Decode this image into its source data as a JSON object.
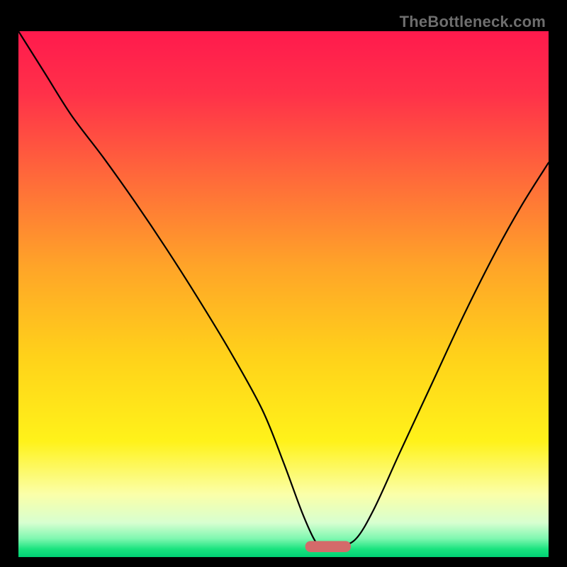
{
  "watermark": "TheBottleneck.com",
  "chart_data": {
    "type": "line",
    "title": "",
    "xlabel": "",
    "ylabel": "",
    "xlim": [
      0,
      100
    ],
    "ylim": [
      0,
      100
    ],
    "grid": false,
    "legend": false,
    "background_gradient_stops": [
      {
        "offset": 0.0,
        "color": "#ff1a4d"
      },
      {
        "offset": 0.12,
        "color": "#ff3149"
      },
      {
        "offset": 0.28,
        "color": "#ff6a3a"
      },
      {
        "offset": 0.45,
        "color": "#ffa528"
      },
      {
        "offset": 0.62,
        "color": "#ffd21a"
      },
      {
        "offset": 0.78,
        "color": "#fff21a"
      },
      {
        "offset": 0.88,
        "color": "#fbffa8"
      },
      {
        "offset": 0.935,
        "color": "#d7ffd0"
      },
      {
        "offset": 0.965,
        "color": "#7ef7b0"
      },
      {
        "offset": 0.985,
        "color": "#19e37e"
      },
      {
        "offset": 1.0,
        "color": "#00d074"
      }
    ],
    "series": [
      {
        "name": "bottleneck-curve",
        "x": [
          0,
          5,
          10,
          16,
          22,
          28,
          34,
          40,
          46,
          50,
          53.5,
          56,
          57.5,
          60,
          63.5,
          67,
          72,
          78,
          84,
          90,
          95,
          100
        ],
        "y": [
          100,
          92,
          84,
          76,
          67.5,
          58.5,
          49,
          39,
          28,
          18,
          8.5,
          3,
          2,
          2,
          3.3,
          9,
          20,
          33,
          46,
          58,
          67,
          75
        ]
      }
    ],
    "marker": {
      "name": "optimal-zone",
      "x": 58.4,
      "y": 2.0,
      "width": 8.6,
      "height": 2.1,
      "color": "#d46a6a"
    }
  }
}
